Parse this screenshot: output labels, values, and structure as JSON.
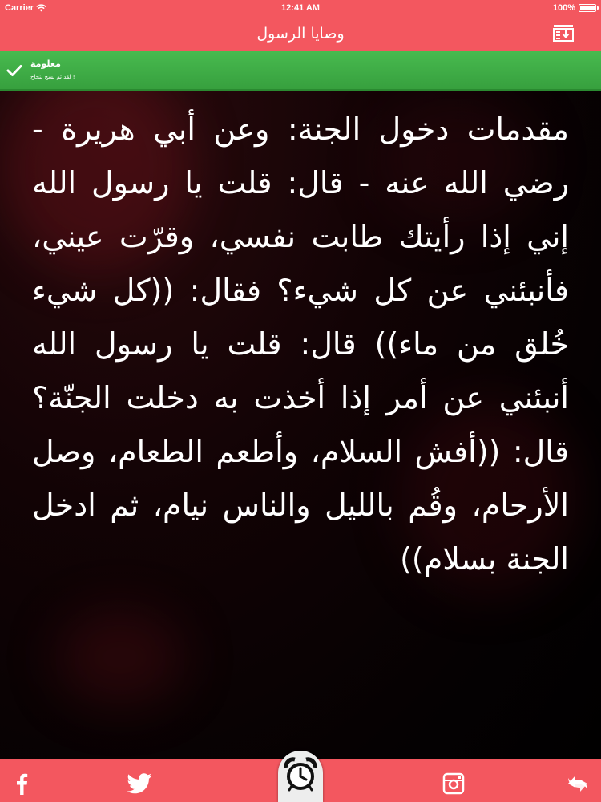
{
  "status_bar": {
    "carrier": "Carrier",
    "time": "12:41 AM",
    "battery": "100%",
    "battery_level": 1.0,
    "wifi_icon": "wifi-icon",
    "battery_icon": "battery-icon"
  },
  "nav": {
    "title": "وصايا الرسول",
    "menu_icon": "list-download-icon"
  },
  "banner": {
    "title": "معلومة",
    "message": "لقد تم نسخ بنجاح !",
    "icon": "check-icon"
  },
  "content": {
    "text": "مقدمات دخول الجنة:  وعن أبي هريرة - رضي الله عنه - قال: قلت يا رسول الله إني إذا رأيتك طابت نفسي، وقرّت عيني، فأنبئني عن كل شيء؟ فقال: ((كل شيء خُلق من ماء)) قال: قلت يا رسول الله أنبئني عن أمر إذا أخذت به دخلت الجنّة؟ قال: ((أفش السلام، وأطعم الطعام، وصل الأرحام، وقُم بالليل والناس نيام، ثم ادخل الجنة بسلام))"
  },
  "toolbar": {
    "icons": [
      "facebook-icon",
      "twitter-icon",
      "alarm-clock-icon",
      "instagram-icon",
      "share-icon"
    ]
  },
  "colors": {
    "header_bg": "#f3575f",
    "banner_bg": "#3aa741",
    "text": "#ffffff",
    "background": "#0a0203"
  }
}
